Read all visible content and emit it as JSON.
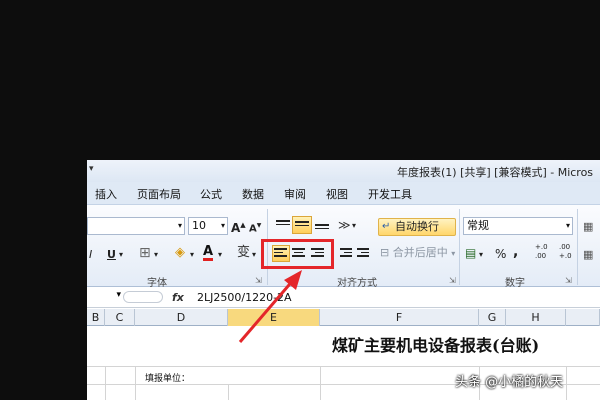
{
  "window": {
    "title": "年度报表(1) [共享] [兼容模式] - Micros"
  },
  "tabs": [
    "插入",
    "页面布局",
    "公式",
    "数据",
    "审阅",
    "视图",
    "开发工具"
  ],
  "font_group": {
    "font_size": "10",
    "grow_label": "A",
    "shrink_label": "A",
    "italic_label": "I",
    "underline_label": "U",
    "font_color_label": "A",
    "phonetic_label": "变",
    "label": "字体"
  },
  "alignment_group": {
    "wrap_text": "自动换行",
    "merge_center": "合并后居中",
    "label": "对齐方式",
    "selected_button": "align-left"
  },
  "number_group": {
    "format": "常规",
    "percent": "%",
    "comma": ",",
    "inc_decimal": "+.0 .00",
    "dec_decimal": ".00 +.0",
    "label": "数字"
  },
  "formula_bar": {
    "fx": "fx",
    "content": "2LJ2500/1220-2A"
  },
  "columns": [
    "B",
    "C",
    "D",
    "E",
    "F",
    "G",
    "H"
  ],
  "selected_column": "E",
  "sheet": {
    "title": "煤矿主要机电设备报表(台账)",
    "fill_unit_label": "填报单位："
  },
  "watermark": "头条 @小橘的秋天",
  "colors": {
    "highlight": "#e4262a",
    "selected_button": "#ffce5a",
    "selected_column": "#f8d97e"
  }
}
